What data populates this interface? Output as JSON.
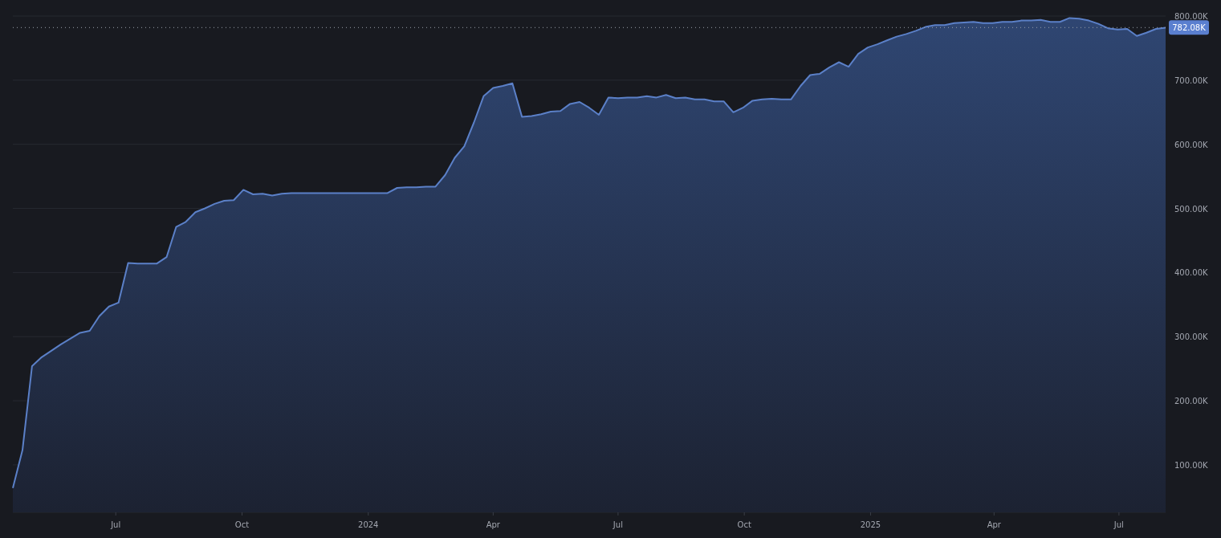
{
  "chart_data": {
    "type": "area",
    "grid": true,
    "x": [
      "2023-04-17",
      "2023-04-24",
      "2023-05-01",
      "2023-05-08",
      "2023-05-15",
      "2023-05-22",
      "2023-05-29",
      "2023-06-05",
      "2023-06-12",
      "2023-06-19",
      "2023-06-26",
      "2023-07-03",
      "2023-07-10",
      "2023-07-17",
      "2023-07-24",
      "2023-07-31",
      "2023-08-07",
      "2023-08-14",
      "2023-08-21",
      "2023-08-28",
      "2023-09-04",
      "2023-09-11",
      "2023-09-18",
      "2023-09-25",
      "2023-10-02",
      "2023-10-09",
      "2023-10-16",
      "2023-10-23",
      "2023-10-30",
      "2023-11-06",
      "2023-11-13",
      "2023-11-20",
      "2023-11-27",
      "2023-12-04",
      "2023-12-11",
      "2023-12-18",
      "2023-12-25",
      "2024-01-01",
      "2024-01-08",
      "2024-01-15",
      "2024-01-22",
      "2024-01-29",
      "2024-02-05",
      "2024-02-12",
      "2024-02-19",
      "2024-02-26",
      "2024-03-04",
      "2024-03-11",
      "2024-03-18",
      "2024-03-25",
      "2024-04-01",
      "2024-04-08",
      "2024-04-15",
      "2024-04-22",
      "2024-04-29",
      "2024-05-06",
      "2024-05-13",
      "2024-05-20",
      "2024-05-27",
      "2024-06-03",
      "2024-06-10",
      "2024-06-17",
      "2024-06-24",
      "2024-07-01",
      "2024-07-08",
      "2024-07-15",
      "2024-07-22",
      "2024-07-29",
      "2024-08-05",
      "2024-08-12",
      "2024-08-19",
      "2024-08-26",
      "2024-09-02",
      "2024-09-09",
      "2024-09-16",
      "2024-09-23",
      "2024-09-30",
      "2024-10-07",
      "2024-10-14",
      "2024-10-21",
      "2024-10-28",
      "2024-11-04",
      "2024-11-11",
      "2024-11-18",
      "2024-11-25",
      "2024-12-02",
      "2024-12-09",
      "2024-12-16",
      "2024-12-23",
      "2024-12-30",
      "2025-01-06",
      "2025-01-13",
      "2025-01-20",
      "2025-01-27",
      "2025-02-03",
      "2025-02-10",
      "2025-02-17",
      "2025-02-24",
      "2025-03-03",
      "2025-03-10",
      "2025-03-17",
      "2025-03-24",
      "2025-03-31",
      "2025-04-07",
      "2025-04-14",
      "2025-04-21",
      "2025-04-28",
      "2025-05-05",
      "2025-05-12",
      "2025-05-19",
      "2025-05-26",
      "2025-06-02",
      "2025-06-09",
      "2025-06-16",
      "2025-06-23",
      "2025-06-30",
      "2025-07-07",
      "2025-07-14",
      "2025-07-21",
      "2025-07-28",
      "2025-08-04"
    ],
    "xlim": [
      "2023-04-17",
      "2025-08-04"
    ],
    "ylim": [
      26,
      800
    ],
    "series": [
      {
        "color": "#5b80c8",
        "values": [
          64,
          123,
          254,
          268,
          278,
          288,
          297,
          306,
          309,
          332,
          347,
          353,
          415,
          414,
          414,
          414,
          424,
          471,
          479,
          494,
          500,
          507,
          512,
          513,
          529,
          522,
          523,
          520,
          523,
          524,
          524,
          524,
          524,
          524,
          524,
          524,
          524,
          524,
          524,
          524,
          532,
          533,
          533,
          534,
          534,
          552,
          579,
          597,
          634,
          675,
          688,
          691,
          695,
          643,
          644,
          647,
          651,
          652,
          663,
          666,
          657,
          646,
          673,
          672,
          673,
          673,
          675,
          673,
          677,
          672,
          673,
          670,
          670,
          667,
          667,
          650,
          657,
          668,
          670,
          671,
          670,
          670,
          691,
          708,
          710,
          720,
          728,
          721,
          741,
          751,
          756,
          762,
          768,
          772,
          777,
          783,
          786,
          786,
          789,
          790,
          791,
          789,
          789,
          791,
          791,
          793,
          793,
          794,
          791,
          791,
          797,
          796,
          793,
          788,
          781,
          779,
          780,
          769,
          774,
          780,
          782
        ]
      }
    ],
    "xticks": [
      {
        "value": "2023-07-01",
        "label": "Jul"
      },
      {
        "value": "2023-10-01",
        "label": "Oct"
      },
      {
        "value": "2024-01-01",
        "label": "2024"
      },
      {
        "value": "2024-04-01",
        "label": "Apr"
      },
      {
        "value": "2024-07-01",
        "label": "Jul"
      },
      {
        "value": "2024-10-01",
        "label": "Oct"
      },
      {
        "value": "2025-01-01",
        "label": "2025"
      },
      {
        "value": "2025-04-01",
        "label": "Apr"
      },
      {
        "value": "2025-07-01",
        "label": "Jul"
      }
    ],
    "yticks": [
      {
        "value": 100,
        "label": "100.00K"
      },
      {
        "value": 200,
        "label": "200.00K"
      },
      {
        "value": 300,
        "label": "300.00K"
      },
      {
        "value": 400,
        "label": "400.00K"
      },
      {
        "value": 500,
        "label": "500.00K"
      },
      {
        "value": 600,
        "label": "600.00K"
      },
      {
        "value": 700,
        "label": "700.00K"
      },
      {
        "value": 800,
        "label": "800.00K"
      }
    ],
    "ref_lines": [
      {
        "axis": "y",
        "value": 782.08,
        "label": "782.08K",
        "color": "#9aa0aa"
      }
    ]
  }
}
